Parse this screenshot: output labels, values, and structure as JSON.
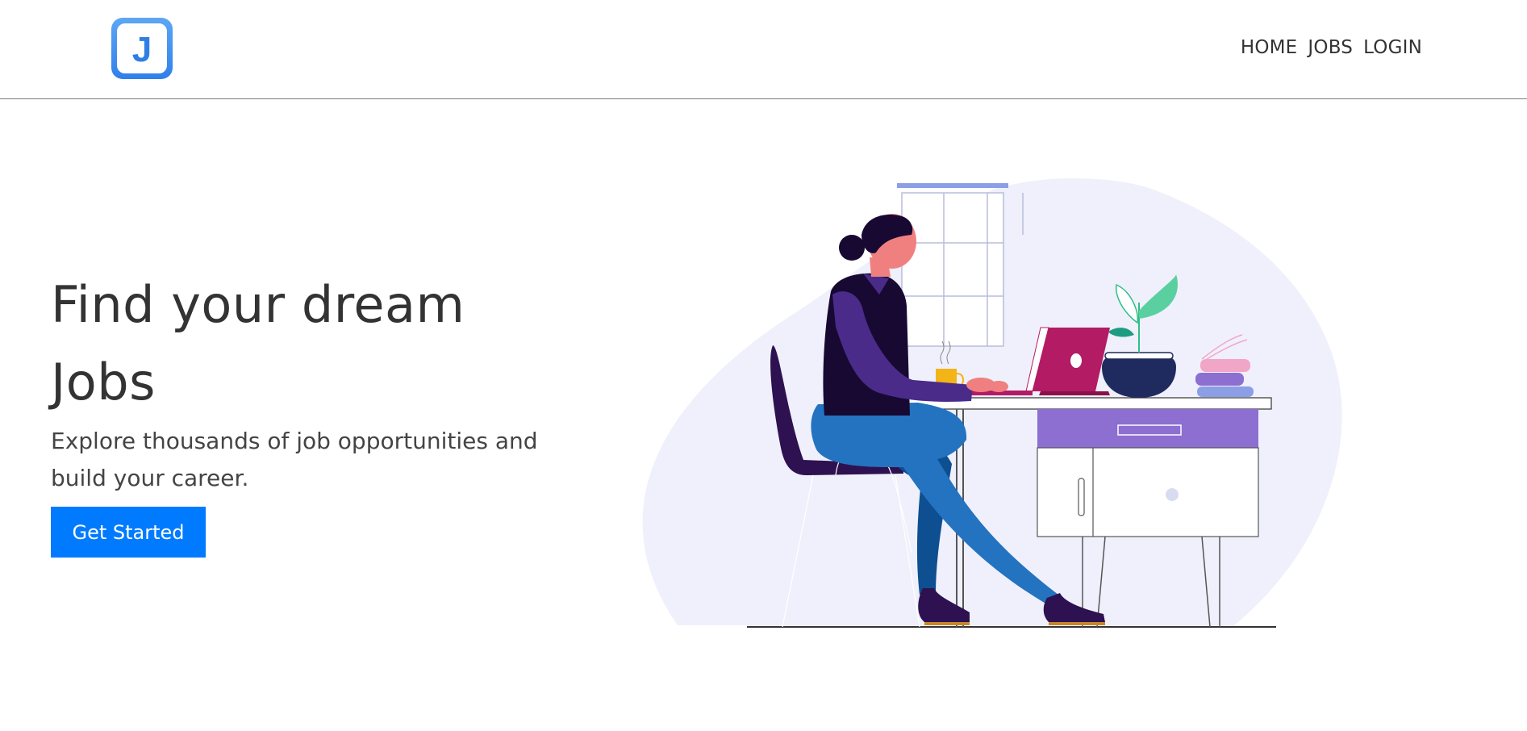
{
  "header": {
    "logo_letter": "J",
    "nav": [
      "HOME",
      "JOBS",
      "LOGIN"
    ]
  },
  "hero": {
    "title_line1": "Find your dream",
    "title_line2": "Jobs",
    "subtitle": "Explore thousands of job opportunities and build your career.",
    "cta_label": "Get Started"
  },
  "colors": {
    "primary": "#007bff",
    "blob": "#eff0fb",
    "laptop": "#b31b65",
    "plant": "#2fbf86"
  },
  "icons": {
    "logo": "j-logo-icon"
  }
}
